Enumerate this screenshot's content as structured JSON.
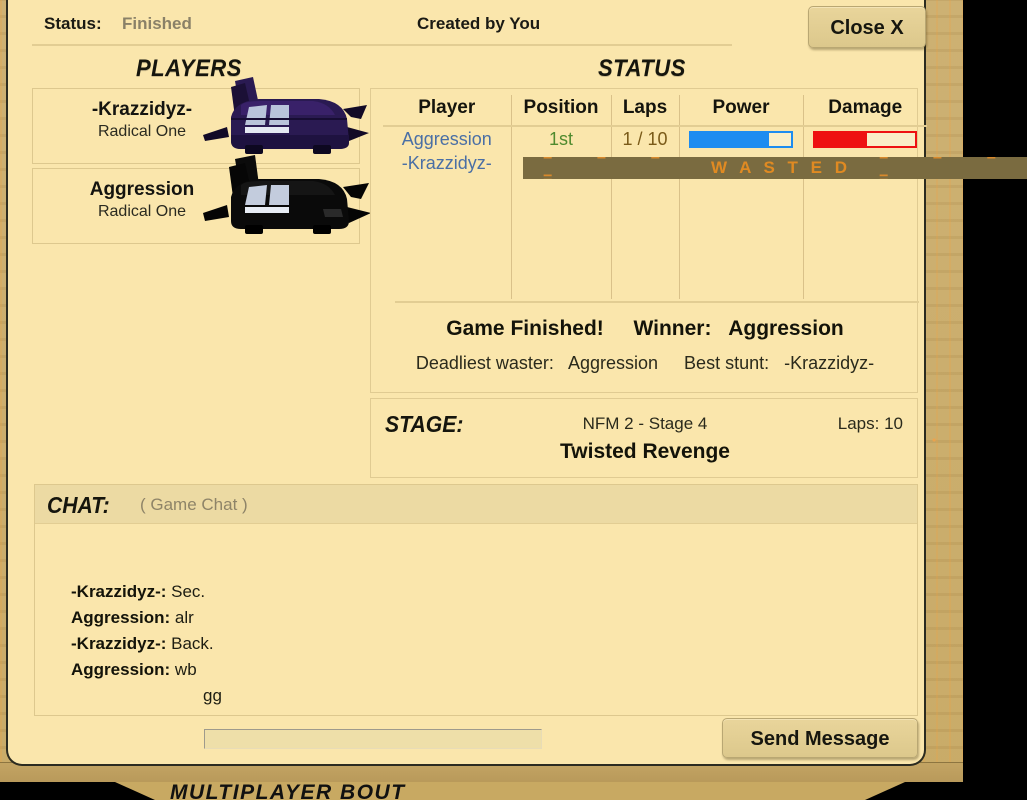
{
  "window": {
    "header": {
      "status_label": "Status:",
      "status_value": "Finished",
      "created_by": "Created by You",
      "close_label": "Close X"
    },
    "players_heading": "PLAYERS",
    "status_heading": "STATUS",
    "stage_heading": "STAGE:",
    "chat_heading": "CHAT:",
    "chat_channel": "( Game Chat )"
  },
  "players": [
    {
      "name": "-Krazzidyz-",
      "car": "Radical One",
      "car_color": "#2a1a52"
    },
    {
      "name": "Aggression",
      "car": "Radical One",
      "car_color": "#0a0a0a"
    }
  ],
  "race_table": {
    "columns": [
      "Player",
      "Position",
      "Laps",
      "Power",
      "Damage"
    ],
    "rows": [
      {
        "player": "Aggression",
        "position": "1st",
        "laps": "1 / 10",
        "power_percent": 78,
        "damage_percent": 52,
        "wasted": false
      },
      {
        "player": "-Krazzidyz-",
        "position": "",
        "laps": "",
        "power_percent": 0,
        "damage_percent": 0,
        "wasted": true,
        "wasted_text": "W A S T E D",
        "wasted_marks": "=   =   =   ="
      }
    ]
  },
  "results": {
    "finished_text": "Game Finished!",
    "winner_label": "Winner:",
    "winner_name": "Aggression",
    "deadliest_waster_label": "Deadliest waster:",
    "deadliest_waster_name": "Aggression",
    "best_stunt_label": "Best stunt:",
    "best_stunt_name": "-Krazzidyz-"
  },
  "stage": {
    "name": "NFM 2 - Stage 4",
    "title": "Twisted Revenge",
    "laps": "Laps: 10"
  },
  "chat": {
    "messages": [
      {
        "who": "-Krazzidyz-:",
        "text": "Sec.",
        "continuation": false
      },
      {
        "who": "Aggression:",
        "text": "alr",
        "continuation": false
      },
      {
        "who": "-Krazzidyz-:",
        "text": "Back.",
        "continuation": false
      },
      {
        "who": "Aggression:",
        "text": "wb",
        "continuation": false
      },
      {
        "who": "",
        "text": "gg",
        "continuation": true
      }
    ],
    "input_value": "",
    "input_placeholder": "",
    "send_label": "Send Message"
  },
  "background": {
    "banner_text": "MULTIPLAYER BOUT"
  },
  "colors": {
    "panel": "#fae6ac",
    "panel_border": "#2b2b20",
    "accent_blue": "#1d8cf0",
    "accent_red": "#ee1111",
    "player_name": "#4a6fa5",
    "position_green": "#4f8a2e",
    "laps_brown": "#7a5a18",
    "wasted_bg": "#7a6b40",
    "wasted_text": "#e08a22",
    "backdrop": "#c9ab68"
  }
}
